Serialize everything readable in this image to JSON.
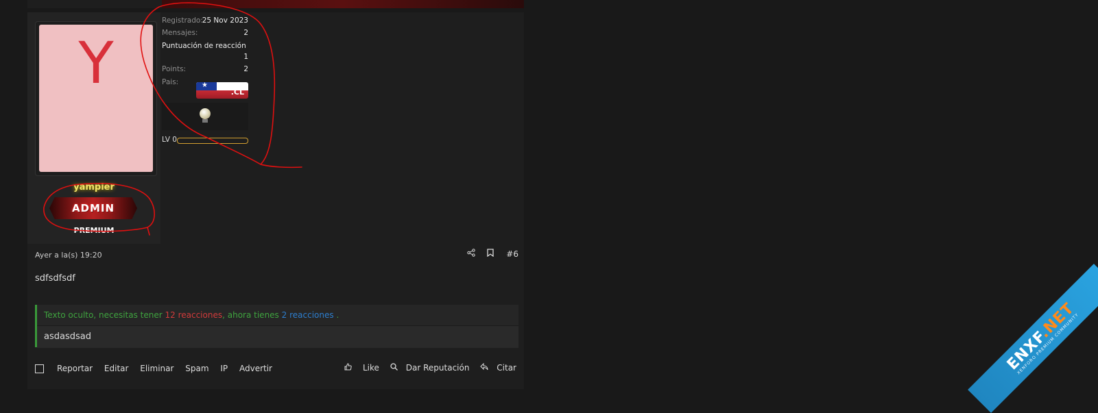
{
  "user": {
    "avatar_letter": "Y",
    "username": "yampier",
    "banner": "ADMIN",
    "title": "PREMIUM"
  },
  "stats": {
    "registered_label": "Registrado:",
    "registered_value": "25 Nov 2023",
    "messages_label": "Mensajes:",
    "messages_value": "2",
    "reaction_label": "Puntuación de reacción",
    "reaction_value": "1",
    "points_label": "Points:",
    "points_value": "2",
    "country_label": "Pais:",
    "country_flag_text": ".CL",
    "level_label": "LV 0",
    "level_progress": 0
  },
  "post": {
    "timestamp": "Ayer a la(s) 19:20",
    "number": "#6",
    "body": "sdfsdfsdf",
    "hidden_notice": {
      "prefix": "Texto oculto, necesitas tener",
      "required": "12 reacciones",
      "middle": ", ahora tienes",
      "current": "2 reacciones",
      "suffix": "."
    },
    "hidden_content": "asdasdsad"
  },
  "footer": {
    "report": "Reportar",
    "edit": "Editar",
    "delete": "Eliminar",
    "spam": "Spam",
    "ip": "IP",
    "warn": "Advertir",
    "like": "Like",
    "reputation": "Dar Reputación",
    "quote": "Citar"
  },
  "watermark": {
    "brand": "ENXF",
    "brand_suffix": ".NET",
    "tagline": "XENFORO PREMIUM COMMUNITY"
  },
  "colors": {
    "background": "#191919",
    "annotation": "#e01010",
    "username_glow": "#f2e36a",
    "hidden_green": "#3fa43f",
    "required_red": "#d23b3b",
    "current_blue": "#2d7fd0",
    "level_bar": "#d4a030"
  }
}
